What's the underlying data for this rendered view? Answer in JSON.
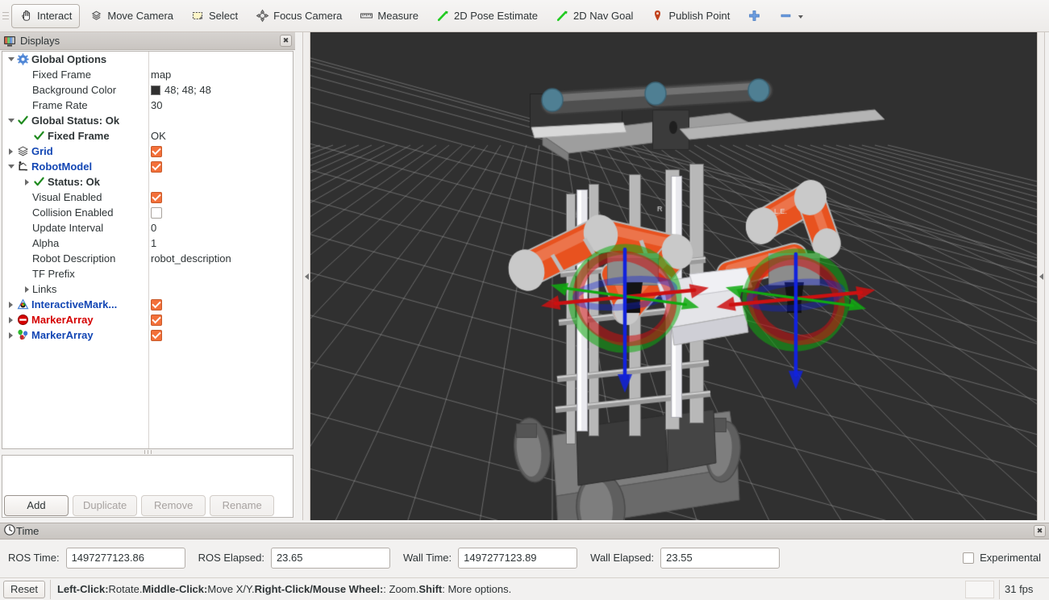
{
  "toolbar": {
    "items": [
      {
        "label": "Interact",
        "icon": "hand-cursor-icon",
        "checked": true
      },
      {
        "label": "Move Camera",
        "icon": "move-camera-icon",
        "checked": false
      },
      {
        "label": "Select",
        "icon": "select-rectangle-icon",
        "checked": false
      },
      {
        "label": "Focus Camera",
        "icon": "focus-camera-icon",
        "checked": false
      },
      {
        "label": "Measure",
        "icon": "ruler-icon",
        "checked": false
      },
      {
        "label": "2D Pose Estimate",
        "icon": "pose-arrow-icon",
        "checked": false
      },
      {
        "label": "2D Nav Goal",
        "icon": "nav-goal-arrow-icon",
        "checked": false
      },
      {
        "label": "Publish Point",
        "icon": "map-pin-icon",
        "checked": false
      }
    ],
    "add_tool_icon": "plus-icon",
    "remove_tool_icon": "minus-icon",
    "overflow_icon": "chevron-down-icon"
  },
  "displays": {
    "title": "Displays",
    "close_icon": "close-icon",
    "panel_icon": "displays-monitor-icon",
    "rows": [
      {
        "indent": 0,
        "expander": "down",
        "icon": "gear-icon",
        "label": "Global Options",
        "style": "bold",
        "value": "",
        "widget": "none"
      },
      {
        "indent": 1,
        "expander": "none",
        "icon": "none",
        "label": "Fixed Frame",
        "style": "plain",
        "value": "map",
        "widget": "none"
      },
      {
        "indent": 1,
        "expander": "none",
        "icon": "none",
        "label": "Background Color",
        "style": "plain",
        "value": "48; 48; 48",
        "widget": "swatch",
        "swatch_color": "#303030"
      },
      {
        "indent": 1,
        "expander": "none",
        "icon": "none",
        "label": "Frame Rate",
        "style": "plain",
        "value": "30",
        "widget": "none"
      },
      {
        "indent": 0,
        "expander": "down",
        "icon": "check-icon",
        "label": "Global Status: Ok",
        "style": "bold",
        "value": "",
        "widget": "none"
      },
      {
        "indent": 1,
        "expander": "none",
        "icon": "check-icon",
        "label": "Fixed Frame",
        "style": "bold",
        "value": "OK",
        "widget": "none"
      },
      {
        "indent": 0,
        "expander": "right",
        "icon": "grid-icon",
        "label": "Grid",
        "style": "blue",
        "value": "",
        "widget": "checkbox-on"
      },
      {
        "indent": 0,
        "expander": "down",
        "icon": "robot-icon",
        "label": "RobotModel",
        "style": "blue",
        "value": "",
        "widget": "checkbox-on"
      },
      {
        "indent": 1,
        "expander": "right",
        "icon": "check-icon",
        "label": "Status: Ok",
        "style": "bold",
        "value": "",
        "widget": "none"
      },
      {
        "indent": 1,
        "expander": "none",
        "icon": "none",
        "label": "Visual Enabled",
        "style": "plain",
        "value": "",
        "widget": "checkbox-on"
      },
      {
        "indent": 1,
        "expander": "none",
        "icon": "none",
        "label": "Collision Enabled",
        "style": "plain",
        "value": "",
        "widget": "checkbox-off"
      },
      {
        "indent": 1,
        "expander": "none",
        "icon": "none",
        "label": "Update Interval",
        "style": "plain",
        "value": "0",
        "widget": "none"
      },
      {
        "indent": 1,
        "expander": "none",
        "icon": "none",
        "label": "Alpha",
        "style": "plain",
        "value": "1",
        "widget": "none"
      },
      {
        "indent": 1,
        "expander": "none",
        "icon": "none",
        "label": "Robot Description",
        "style": "plain",
        "value": "robot_description",
        "widget": "none"
      },
      {
        "indent": 1,
        "expander": "none",
        "icon": "none",
        "label": "TF Prefix",
        "style": "plain",
        "value": "",
        "widget": "none"
      },
      {
        "indent": 1,
        "expander": "right",
        "icon": "none",
        "label": "Links",
        "style": "plain",
        "value": "",
        "widget": "none"
      },
      {
        "indent": 0,
        "expander": "right",
        "icon": "interactive-marker-icon",
        "label": "InteractiveMark...",
        "style": "blue",
        "value": "",
        "widget": "checkbox-on"
      },
      {
        "indent": 0,
        "expander": "right",
        "icon": "no-entry-icon",
        "label": "MarkerArray",
        "style": "red",
        "value": "",
        "widget": "checkbox-on"
      },
      {
        "indent": 0,
        "expander": "right",
        "icon": "balloons-icon",
        "label": "MarkerArray",
        "style": "blue",
        "value": "",
        "widget": "checkbox-on"
      }
    ],
    "buttons": [
      {
        "label": "Add",
        "enabled": true
      },
      {
        "label": "Duplicate",
        "enabled": false
      },
      {
        "label": "Remove",
        "enabled": false
      },
      {
        "label": "Rename",
        "enabled": false
      }
    ]
  },
  "time": {
    "title": "Time",
    "clock_icon": "clock-icon",
    "close_icon": "close-icon",
    "fields": [
      {
        "label": "ROS Time:",
        "value": "1497277123.86"
      },
      {
        "label": "ROS Elapsed:",
        "value": "23.65"
      },
      {
        "label": "Wall Time:",
        "value": "1497277123.89"
      },
      {
        "label": "Wall Elapsed:",
        "value": "23.55"
      }
    ],
    "experimental_label": "Experimental",
    "experimental_checked": false
  },
  "statusbar": {
    "reset_label": "Reset",
    "hint_parts": [
      {
        "text": "Left-Click:",
        "bold": true
      },
      {
        "text": " Rotate. ",
        "bold": false
      },
      {
        "text": "Middle-Click:",
        "bold": true
      },
      {
        "text": " Move X/Y. ",
        "bold": false
      },
      {
        "text": "Right-Click/Mouse Wheel:",
        "bold": true
      },
      {
        "text": ": Zoom. ",
        "bold": false
      },
      {
        "text": "Shift",
        "bold": true
      },
      {
        "text": ": More options.",
        "bold": false
      }
    ],
    "fps": "31 fps"
  },
  "viewport": {
    "background_color": "#303030",
    "grid_color": "#9a9a9a",
    "scene": "dual-arm mobile manipulator robot with two interactive 6-DOF markers",
    "robot_arm_color": "#e8521f",
    "robot_metal_color": "#b8b8b8",
    "marker_axis_x_color": "#cc1111",
    "marker_axis_y_color": "#11aa11",
    "marker_axis_z_color": "#1122dd",
    "collapse_handle_left_icon": "collapse-left-icon",
    "collapse_handle_right_icon": "collapse-right-icon"
  }
}
